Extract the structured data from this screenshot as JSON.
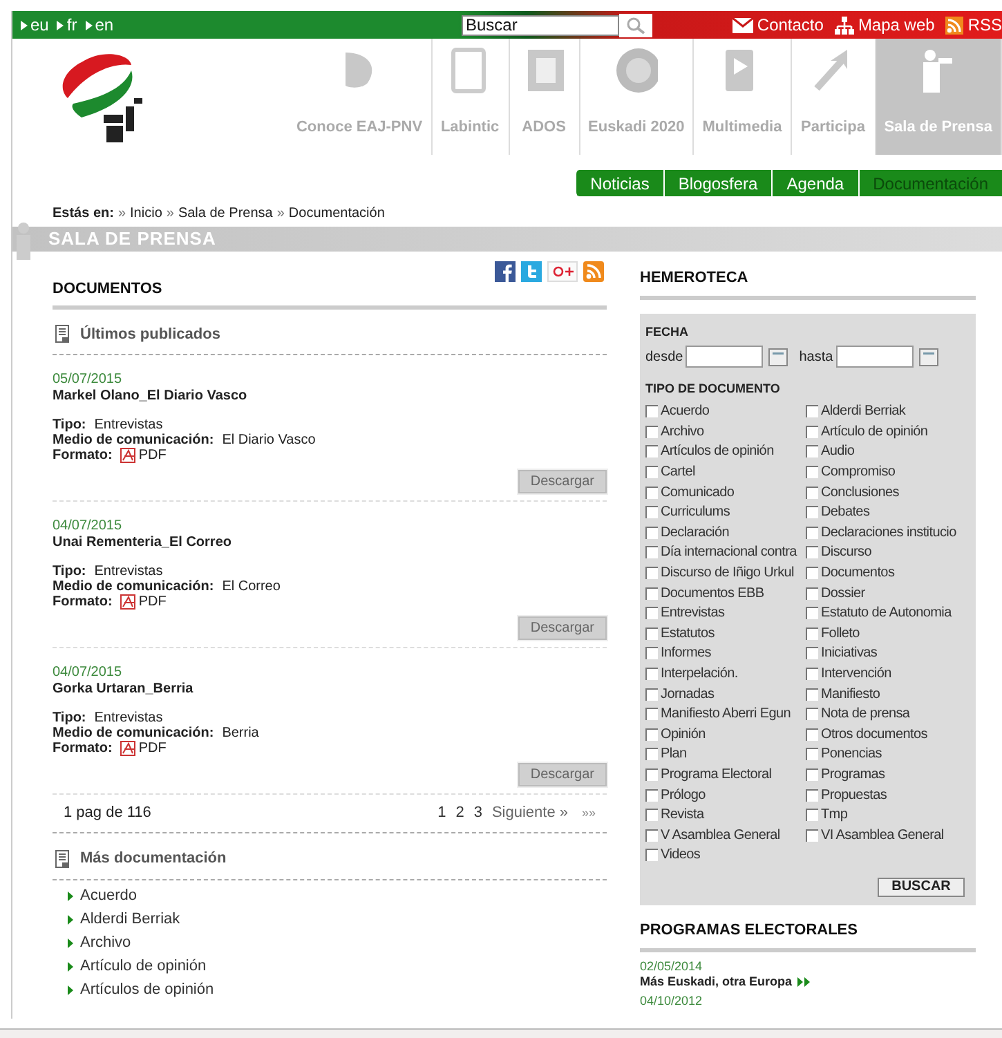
{
  "top_bar": {
    "languages": [
      "eu",
      "fr",
      "en"
    ],
    "search": {
      "value": "Buscar"
    },
    "links": [
      {
        "kind": "mail",
        "label": "Contacto"
      },
      {
        "kind": "sitemap",
        "label": "Mapa web"
      },
      {
        "kind": "rss",
        "label": "RSS"
      }
    ]
  },
  "nav": [
    {
      "label": "Conoce EAJ-PNV",
      "selected": false
    },
    {
      "label": "Labintic",
      "selected": false
    },
    {
      "label": "ADOS",
      "selected": false
    },
    {
      "label": "Euskadi 2020",
      "selected": false
    },
    {
      "label": "Multimedia",
      "selected": false
    },
    {
      "label": "Participa",
      "selected": false
    },
    {
      "label": "Sala de Prensa",
      "selected": true
    }
  ],
  "subnav": [
    {
      "label": "Noticias",
      "selected": false
    },
    {
      "label": "Blogosfera",
      "selected": false
    },
    {
      "label": "Agenda",
      "selected": false
    },
    {
      "label": "Documentación",
      "selected": true
    }
  ],
  "breadcrumb": {
    "label": "Estás en:",
    "separator": "»",
    "items": [
      "Inicio",
      "Sala de Prensa",
      "Documentación"
    ]
  },
  "section_title": "SALA DE PRENSA",
  "documents": {
    "title": "DOCUMENTOS",
    "latest_title": "Últimos publicados",
    "items": [
      {
        "date": "05/07/2015",
        "title": "Markel Olano_El Diario Vasco",
        "fields": [
          {
            "label": "Tipo:",
            "value": "Entrevistas"
          },
          {
            "label": "Medio de comunicación:",
            "value": "El Diario Vasco"
          }
        ],
        "format_label": "Formato:",
        "format": "PDF",
        "button": "Descargar"
      },
      {
        "date": "04/07/2015",
        "title": "Unai Rementeria_El Correo",
        "fields": [
          {
            "label": "Tipo:",
            "value": "Entrevistas"
          },
          {
            "label": "Medio de comunicación:",
            "value": "El Correo"
          }
        ],
        "format_label": "Formato:",
        "format": "PDF",
        "button": "Descargar"
      },
      {
        "date": "04/07/2015",
        "title": "Gorka Urtaran_Berria",
        "fields": [
          {
            "label": "Tipo:",
            "value": "Entrevistas"
          },
          {
            "label": "Medio de comunicación:",
            "value": "Berria"
          }
        ],
        "format_label": "Formato:",
        "format": "PDF",
        "button": "Descargar"
      }
    ],
    "pagination": {
      "summary": "1 pag de 116",
      "pages": [
        "1",
        "2",
        "3"
      ],
      "next": "Siguiente »",
      "last": "»»"
    },
    "more_title": "Más documentación",
    "more_items": [
      "Acuerdo",
      "Alderdi Berriak",
      "Archivo",
      "Artículo de opinión",
      "Artículos de opinión"
    ]
  },
  "hemeroteca": {
    "title": "HEMEROTECA",
    "date_title": "FECHA",
    "from_label": "desde",
    "to_label": "hasta",
    "type_title": "TIPO DE DOCUMENTO",
    "types": [
      {
        "label": "Acuerdo",
        "checked": false
      },
      {
        "label": "Alderdi Berriak",
        "checked": false
      },
      {
        "label": "Archivo",
        "checked": false
      },
      {
        "label": "Artículo de opinión",
        "checked": false
      },
      {
        "label": "Artículos de opinión",
        "checked": false
      },
      {
        "label": "Audio",
        "checked": false
      },
      {
        "label": "Cartel",
        "checked": false
      },
      {
        "label": "Compromiso",
        "checked": false
      },
      {
        "label": "Comunicado",
        "checked": false
      },
      {
        "label": "Conclusiones",
        "checked": false
      },
      {
        "label": "Curriculums",
        "checked": false
      },
      {
        "label": "Debates",
        "checked": false
      },
      {
        "label": "Declaración",
        "checked": false
      },
      {
        "label": "Declaraciones institucio",
        "checked": false
      },
      {
        "label": "Día internacional contra",
        "checked": false
      },
      {
        "label": "Discurso",
        "checked": false
      },
      {
        "label": "Discurso de Iñigo Urkul",
        "checked": false
      },
      {
        "label": "Documentos",
        "checked": false
      },
      {
        "label": "Documentos EBB",
        "checked": false
      },
      {
        "label": "Dossier",
        "checked": false
      },
      {
        "label": "Entrevistas",
        "checked": false
      },
      {
        "label": "Estatuto de Autonomia",
        "checked": false
      },
      {
        "label": "Estatutos",
        "checked": false
      },
      {
        "label": "Folleto",
        "checked": false
      },
      {
        "label": "Informes",
        "checked": false
      },
      {
        "label": "Iniciativas",
        "checked": false
      },
      {
        "label": "Interpelación.",
        "checked": false
      },
      {
        "label": "Intervención",
        "checked": false
      },
      {
        "label": "Jornadas",
        "checked": false
      },
      {
        "label": "Manifiesto",
        "checked": false
      },
      {
        "label": "Manifiesto Aberri Egun",
        "checked": false
      },
      {
        "label": "Nota de prensa",
        "checked": false
      },
      {
        "label": "Opinión",
        "checked": false
      },
      {
        "label": "Otros documentos",
        "checked": false
      },
      {
        "label": "Plan",
        "checked": false
      },
      {
        "label": "Ponencias",
        "checked": false
      },
      {
        "label": "Programa Electoral",
        "checked": false
      },
      {
        "label": "Programas",
        "checked": false
      },
      {
        "label": "Prólogo",
        "checked": false
      },
      {
        "label": "Propuestas",
        "checked": false
      },
      {
        "label": "Revista",
        "checked": false
      },
      {
        "label": "Tmp",
        "checked": false
      },
      {
        "label": "V Asamblea General",
        "checked": false
      },
      {
        "label": "VI Asamblea General",
        "checked": false
      },
      {
        "label": "Videos",
        "checked": false
      }
    ],
    "button": "BUSCAR"
  },
  "programs": {
    "title": "PROGRAMAS ELECTORALES",
    "items": [
      {
        "date": "02/05/2014",
        "title": "Más Euskadi, otra Europa"
      },
      {
        "date": "04/10/2012"
      }
    ]
  }
}
